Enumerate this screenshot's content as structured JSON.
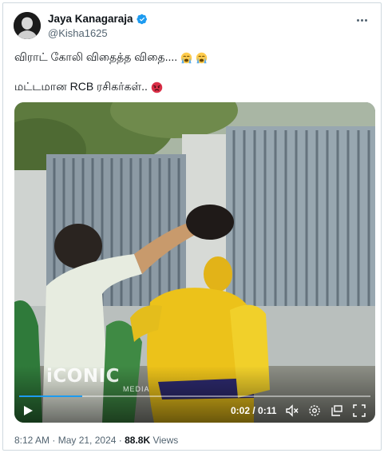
{
  "author": {
    "display_name": "Jaya Kanagaraja",
    "handle": "@Kisha1625",
    "verified_color": "#1d9bf0",
    "avatar_icon": "person-portrait-avatar"
  },
  "tweet": {
    "line1": "விராட் கோலி விதைத்த விதை....",
    "line1_emoji": [
      "loudly-crying-face",
      "loudly-crying-face"
    ],
    "line2": "மட்டமான RCB ரசிகர்கள்..",
    "line2_emoji": [
      "angry-face"
    ]
  },
  "video": {
    "watermark": "iCONIC",
    "watermark_sub": "MEDIA",
    "time": "0:02 / 0:11",
    "progress": 0.18,
    "controls": [
      "play-icon",
      "mute-icon",
      "settings-icon",
      "picture-in-picture-icon",
      "fullscreen-icon"
    ]
  },
  "meta": {
    "time": "8:12 AM",
    "sep1": " · ",
    "date": "May 21, 2024",
    "sep2": " · ",
    "views_count": "88.8K",
    "views_label": " Views"
  },
  "colors": {
    "accent": "#1d9bf0",
    "text_primary": "#0f1419",
    "text_secondary": "#536471"
  }
}
